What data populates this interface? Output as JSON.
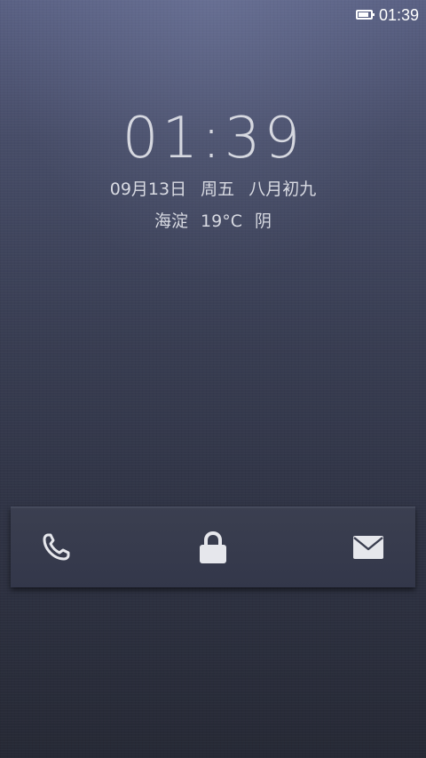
{
  "status_bar": {
    "time": "01:39",
    "battery_icon": "battery-full-icon",
    "color": "#ffffff"
  },
  "lockscreen": {
    "clock": "01:39",
    "date": {
      "day": "09月13日",
      "weekday": "周五",
      "lunar": "八月初九"
    },
    "weather": {
      "location": "海淀",
      "temperature": "19°C",
      "condition": "阴"
    }
  },
  "unlock_bar": {
    "shortcuts": [
      {
        "name": "phone",
        "icon": "phone-icon"
      },
      {
        "name": "unlock",
        "icon": "lock-icon"
      },
      {
        "name": "messages",
        "icon": "mail-icon"
      }
    ],
    "icon_color": "#e6e7ec"
  },
  "colors": {
    "background_top": "#5a6184",
    "background_bottom": "#262935",
    "text": "#d8dae2"
  }
}
